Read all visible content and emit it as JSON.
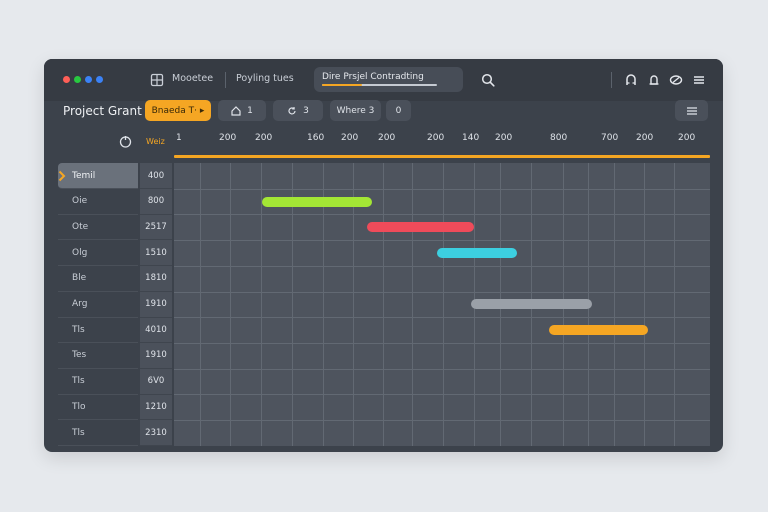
{
  "topbar": {
    "menu1": "Mooetee",
    "menu2": "Poyling tues",
    "search_value": "Dire Prsjel Contradting",
    "icons": [
      "search-icon",
      "magnet-icon",
      "bell-icon",
      "link-icon",
      "hamburger-icon"
    ]
  },
  "toolbar": {
    "title": "Project Grant",
    "accent_button": "Bnaeda T· ▸",
    "btn1": "1",
    "btn2": "3",
    "btn3": "Where 3",
    "btn4": "0"
  },
  "grid": {
    "week_label": "Weiz",
    "header_ticks": [
      "1",
      "200",
      "200",
      "160",
      "200",
      "200",
      "200",
      "140",
      "200",
      "800",
      "700",
      "200",
      "200"
    ],
    "rows": [
      {
        "label": "Temil",
        "value": "400",
        "active": true
      },
      {
        "label": "Oie",
        "value": "800"
      },
      {
        "label": "Ote",
        "value": "2517"
      },
      {
        "label": "Olg",
        "value": "1510"
      },
      {
        "label": "Ble",
        "value": "1810"
      },
      {
        "label": "Arg",
        "value": "1910"
      },
      {
        "label": "Tls",
        "value": "4010"
      },
      {
        "label": "Tes",
        "value": "1910"
      },
      {
        "label": "Tls",
        "value": "6V0"
      },
      {
        "label": "Tlo",
        "value": "1210"
      },
      {
        "label": "Tls",
        "value": "2310"
      }
    ],
    "bars": [
      {
        "row": 1,
        "start": 0.165,
        "end": 0.37,
        "color": "#a3e635"
      },
      {
        "row": 2,
        "start": 0.36,
        "end": 0.56,
        "color": "#ef4b5a"
      },
      {
        "row": 3,
        "start": 0.49,
        "end": 0.64,
        "color": "#3ccfe0"
      },
      {
        "row": 5,
        "start": 0.555,
        "end": 0.78,
        "color": "#9aa0a8"
      },
      {
        "row": 6,
        "start": 0.7,
        "end": 0.885,
        "color": "#f5a623"
      }
    ]
  },
  "colors": {
    "accent": "#f5a623",
    "window_bg": "#3c424b",
    "page_bg": "#e6e9ed"
  }
}
